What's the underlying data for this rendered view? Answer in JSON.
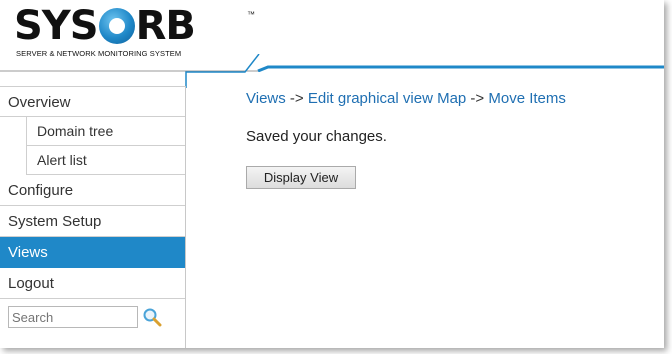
{
  "header": {
    "logo_text_left": "SYS",
    "logo_text_right": "RB",
    "trademark": "™",
    "subtitle": "SERVER & NETWORK MONITORING SYSTEM"
  },
  "colors": {
    "accent": "#1f88c8",
    "link": "#1f6fb2"
  },
  "sidebar": {
    "items": [
      {
        "label": "Overview"
      },
      {
        "label": "Domain tree",
        "sub": true
      },
      {
        "label": "Alert list",
        "sub": true
      },
      {
        "label": "Configure"
      },
      {
        "label": "System Setup"
      },
      {
        "label": "Views",
        "active": true
      },
      {
        "label": "Logout"
      }
    ],
    "search": {
      "placeholder": "Search",
      "icon": "magnifier-icon"
    }
  },
  "main": {
    "breadcrumb": {
      "views": "Views",
      "sep1": " -> ",
      "edit": "Edit graphical view Map",
      "sep2": " -> ",
      "move": "Move Items"
    },
    "message": "Saved your changes.",
    "button_label": "Display View"
  }
}
